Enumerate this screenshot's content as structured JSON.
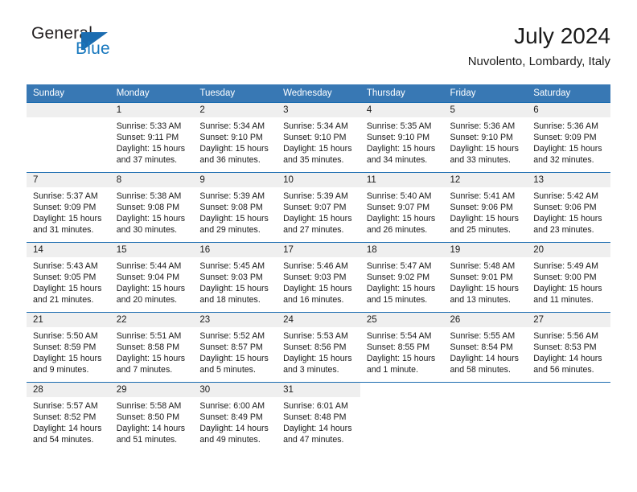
{
  "brand": {
    "word_one": "General",
    "word_two": "Blue",
    "flag_icon": "triangle-flag-icon"
  },
  "header": {
    "title": "July 2024",
    "subtitle": "Nuvolento, Lombardy, Italy"
  },
  "colors": {
    "header_blue": "#3878b4",
    "rule_blue": "#1b6cb0",
    "daynum_band": "#efefef",
    "brand_blue": "#1878be",
    "text": "#1a1a1a"
  },
  "calendar": {
    "weekday_headers": [
      "Sunday",
      "Monday",
      "Tuesday",
      "Wednesday",
      "Thursday",
      "Friday",
      "Saturday"
    ],
    "weeks": [
      [
        {
          "day": "",
          "sunrise": "",
          "sunset": "",
          "daylight_line1": "",
          "daylight_line2": ""
        },
        {
          "day": "1",
          "sunrise": "Sunrise: 5:33 AM",
          "sunset": "Sunset: 9:11 PM",
          "daylight_line1": "Daylight: 15 hours",
          "daylight_line2": "and 37 minutes."
        },
        {
          "day": "2",
          "sunrise": "Sunrise: 5:34 AM",
          "sunset": "Sunset: 9:10 PM",
          "daylight_line1": "Daylight: 15 hours",
          "daylight_line2": "and 36 minutes."
        },
        {
          "day": "3",
          "sunrise": "Sunrise: 5:34 AM",
          "sunset": "Sunset: 9:10 PM",
          "daylight_line1": "Daylight: 15 hours",
          "daylight_line2": "and 35 minutes."
        },
        {
          "day": "4",
          "sunrise": "Sunrise: 5:35 AM",
          "sunset": "Sunset: 9:10 PM",
          "daylight_line1": "Daylight: 15 hours",
          "daylight_line2": "and 34 minutes."
        },
        {
          "day": "5",
          "sunrise": "Sunrise: 5:36 AM",
          "sunset": "Sunset: 9:10 PM",
          "daylight_line1": "Daylight: 15 hours",
          "daylight_line2": "and 33 minutes."
        },
        {
          "day": "6",
          "sunrise": "Sunrise: 5:36 AM",
          "sunset": "Sunset: 9:09 PM",
          "daylight_line1": "Daylight: 15 hours",
          "daylight_line2": "and 32 minutes."
        }
      ],
      [
        {
          "day": "7",
          "sunrise": "Sunrise: 5:37 AM",
          "sunset": "Sunset: 9:09 PM",
          "daylight_line1": "Daylight: 15 hours",
          "daylight_line2": "and 31 minutes."
        },
        {
          "day": "8",
          "sunrise": "Sunrise: 5:38 AM",
          "sunset": "Sunset: 9:08 PM",
          "daylight_line1": "Daylight: 15 hours",
          "daylight_line2": "and 30 minutes."
        },
        {
          "day": "9",
          "sunrise": "Sunrise: 5:39 AM",
          "sunset": "Sunset: 9:08 PM",
          "daylight_line1": "Daylight: 15 hours",
          "daylight_line2": "and 29 minutes."
        },
        {
          "day": "10",
          "sunrise": "Sunrise: 5:39 AM",
          "sunset": "Sunset: 9:07 PM",
          "daylight_line1": "Daylight: 15 hours",
          "daylight_line2": "and 27 minutes."
        },
        {
          "day": "11",
          "sunrise": "Sunrise: 5:40 AM",
          "sunset": "Sunset: 9:07 PM",
          "daylight_line1": "Daylight: 15 hours",
          "daylight_line2": "and 26 minutes."
        },
        {
          "day": "12",
          "sunrise": "Sunrise: 5:41 AM",
          "sunset": "Sunset: 9:06 PM",
          "daylight_line1": "Daylight: 15 hours",
          "daylight_line2": "and 25 minutes."
        },
        {
          "day": "13",
          "sunrise": "Sunrise: 5:42 AM",
          "sunset": "Sunset: 9:06 PM",
          "daylight_line1": "Daylight: 15 hours",
          "daylight_line2": "and 23 minutes."
        }
      ],
      [
        {
          "day": "14",
          "sunrise": "Sunrise: 5:43 AM",
          "sunset": "Sunset: 9:05 PM",
          "daylight_line1": "Daylight: 15 hours",
          "daylight_line2": "and 21 minutes."
        },
        {
          "day": "15",
          "sunrise": "Sunrise: 5:44 AM",
          "sunset": "Sunset: 9:04 PM",
          "daylight_line1": "Daylight: 15 hours",
          "daylight_line2": "and 20 minutes."
        },
        {
          "day": "16",
          "sunrise": "Sunrise: 5:45 AM",
          "sunset": "Sunset: 9:03 PM",
          "daylight_line1": "Daylight: 15 hours",
          "daylight_line2": "and 18 minutes."
        },
        {
          "day": "17",
          "sunrise": "Sunrise: 5:46 AM",
          "sunset": "Sunset: 9:03 PM",
          "daylight_line1": "Daylight: 15 hours",
          "daylight_line2": "and 16 minutes."
        },
        {
          "day": "18",
          "sunrise": "Sunrise: 5:47 AM",
          "sunset": "Sunset: 9:02 PM",
          "daylight_line1": "Daylight: 15 hours",
          "daylight_line2": "and 15 minutes."
        },
        {
          "day": "19",
          "sunrise": "Sunrise: 5:48 AM",
          "sunset": "Sunset: 9:01 PM",
          "daylight_line1": "Daylight: 15 hours",
          "daylight_line2": "and 13 minutes."
        },
        {
          "day": "20",
          "sunrise": "Sunrise: 5:49 AM",
          "sunset": "Sunset: 9:00 PM",
          "daylight_line1": "Daylight: 15 hours",
          "daylight_line2": "and 11 minutes."
        }
      ],
      [
        {
          "day": "21",
          "sunrise": "Sunrise: 5:50 AM",
          "sunset": "Sunset: 8:59 PM",
          "daylight_line1": "Daylight: 15 hours",
          "daylight_line2": "and 9 minutes."
        },
        {
          "day": "22",
          "sunrise": "Sunrise: 5:51 AM",
          "sunset": "Sunset: 8:58 PM",
          "daylight_line1": "Daylight: 15 hours",
          "daylight_line2": "and 7 minutes."
        },
        {
          "day": "23",
          "sunrise": "Sunrise: 5:52 AM",
          "sunset": "Sunset: 8:57 PM",
          "daylight_line1": "Daylight: 15 hours",
          "daylight_line2": "and 5 minutes."
        },
        {
          "day": "24",
          "sunrise": "Sunrise: 5:53 AM",
          "sunset": "Sunset: 8:56 PM",
          "daylight_line1": "Daylight: 15 hours",
          "daylight_line2": "and 3 minutes."
        },
        {
          "day": "25",
          "sunrise": "Sunrise: 5:54 AM",
          "sunset": "Sunset: 8:55 PM",
          "daylight_line1": "Daylight: 15 hours",
          "daylight_line2": "and 1 minute."
        },
        {
          "day": "26",
          "sunrise": "Sunrise: 5:55 AM",
          "sunset": "Sunset: 8:54 PM",
          "daylight_line1": "Daylight: 14 hours",
          "daylight_line2": "and 58 minutes."
        },
        {
          "day": "27",
          "sunrise": "Sunrise: 5:56 AM",
          "sunset": "Sunset: 8:53 PM",
          "daylight_line1": "Daylight: 14 hours",
          "daylight_line2": "and 56 minutes."
        }
      ],
      [
        {
          "day": "28",
          "sunrise": "Sunrise: 5:57 AM",
          "sunset": "Sunset: 8:52 PM",
          "daylight_line1": "Daylight: 14 hours",
          "daylight_line2": "and 54 minutes."
        },
        {
          "day": "29",
          "sunrise": "Sunrise: 5:58 AM",
          "sunset": "Sunset: 8:50 PM",
          "daylight_line1": "Daylight: 14 hours",
          "daylight_line2": "and 51 minutes."
        },
        {
          "day": "30",
          "sunrise": "Sunrise: 6:00 AM",
          "sunset": "Sunset: 8:49 PM",
          "daylight_line1": "Daylight: 14 hours",
          "daylight_line2": "and 49 minutes."
        },
        {
          "day": "31",
          "sunrise": "Sunrise: 6:01 AM",
          "sunset": "Sunset: 8:48 PM",
          "daylight_line1": "Daylight: 14 hours",
          "daylight_line2": "and 47 minutes."
        },
        {
          "day": "",
          "sunrise": "",
          "sunset": "",
          "daylight_line1": "",
          "daylight_line2": ""
        },
        {
          "day": "",
          "sunrise": "",
          "sunset": "",
          "daylight_line1": "",
          "daylight_line2": ""
        },
        {
          "day": "",
          "sunrise": "",
          "sunset": "",
          "daylight_line1": "",
          "daylight_line2": ""
        }
      ]
    ]
  }
}
